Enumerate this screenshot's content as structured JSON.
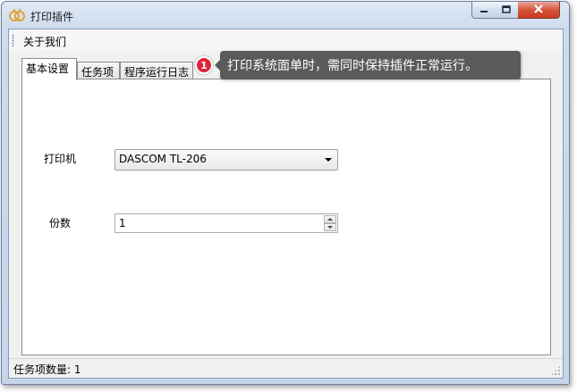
{
  "window": {
    "title": "打印插件",
    "icon": "app-rings-icon",
    "controls": {
      "minimize": "minimize-icon",
      "maximize": "maximize-icon",
      "close": "close-icon"
    }
  },
  "menu": {
    "items": [
      {
        "label": "关于我们"
      }
    ]
  },
  "tabs": [
    {
      "label": "基本设置",
      "active": true
    },
    {
      "label": "任务项",
      "active": false
    },
    {
      "label": "程序运行日志",
      "active": false
    }
  ],
  "form": {
    "printer": {
      "label": "打印机",
      "value": "DASCOM TL-206"
    },
    "copies": {
      "label": "份数",
      "value": "1"
    }
  },
  "status": {
    "label": "任务项数量:",
    "value": "1"
  },
  "callout": {
    "number": "1",
    "text": "打印系统面单时，需同时保持插件正常运行。",
    "badge_color": "#e0263a",
    "bubble_color": "#5a5a5a"
  }
}
